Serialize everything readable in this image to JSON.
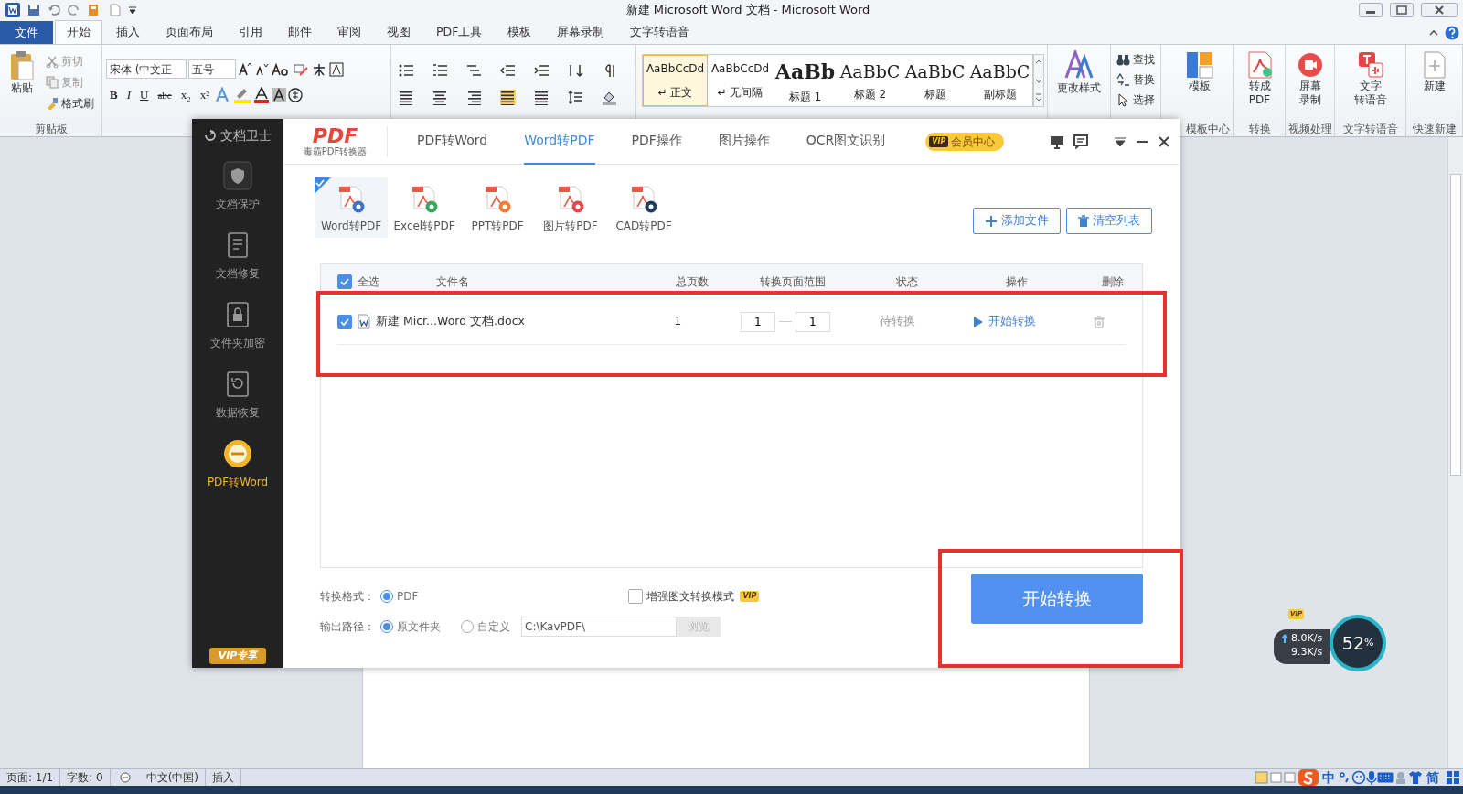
{
  "word": {
    "title": "新建 Microsoft Word 文档 - Microsoft Word",
    "file_tab": "文件",
    "tabs": [
      {
        "label": "开始",
        "selected": true
      },
      {
        "label": "插入",
        "selected": false
      },
      {
        "label": "页面布局",
        "selected": false
      },
      {
        "label": "引用",
        "selected": false
      },
      {
        "label": "邮件",
        "selected": false
      },
      {
        "label": "审阅",
        "selected": false
      },
      {
        "label": "视图",
        "selected": false
      },
      {
        "label": "PDF工具",
        "selected": false
      },
      {
        "label": "模板",
        "selected": false
      },
      {
        "label": "屏幕录制",
        "selected": false
      },
      {
        "label": "文字转语音",
        "selected": false
      }
    ],
    "clipboard": {
      "paste": "粘贴",
      "items": [
        {
          "label": "剪切",
          "disabled": true
        },
        {
          "label": "复制",
          "disabled": true
        },
        {
          "label": "格式刷",
          "disabled": false
        }
      ],
      "group": "剪贴板"
    },
    "font": {
      "name": "宋体 (中文正",
      "size": "五号",
      "buttons": [
        "B",
        "I",
        "U",
        "abc",
        "x₂",
        "x²"
      ]
    },
    "styles": [
      {
        "preview": "AaBbCcDd",
        "label": "↵ 正文",
        "kind": "text",
        "selected": true
      },
      {
        "preview": "AaBbCcDd",
        "label": "↵ 无间隔",
        "kind": "text",
        "selected": false
      },
      {
        "preview": "AaBb",
        "label": "标题 1",
        "kind": "heading1",
        "selected": false
      },
      {
        "preview": "AaBbC",
        "label": "标题 2",
        "kind": "heading",
        "selected": false
      },
      {
        "preview": "AaBbC",
        "label": "标题",
        "kind": "heading",
        "selected": false
      },
      {
        "preview": "AaBbC",
        "label": "副标题",
        "kind": "heading",
        "selected": false
      }
    ],
    "change_styles": "更改样式",
    "editing": [
      "查找",
      "替换",
      "选择"
    ],
    "groups": [
      {
        "lines": [
          "模板"
        ],
        "group": "模板中心",
        "kind": "template"
      },
      {
        "lines": [
          "转成",
          "PDF"
        ],
        "group": "转换",
        "kind": "pdf"
      },
      {
        "lines": [
          "屏幕",
          "录制"
        ],
        "group": "视频处理",
        "kind": "record"
      },
      {
        "lines": [
          "文字",
          "转语音"
        ],
        "group": "文字转语音",
        "kind": "speech"
      },
      {
        "lines": [
          "新建"
        ],
        "group": "快速新建",
        "kind": "new"
      }
    ],
    "status_bar": [
      "页面: 1/1",
      "字数: 0",
      "中文(中国)",
      "插入"
    ],
    "ime": [
      "中",
      "简"
    ]
  },
  "dialog": {
    "sidebar": {
      "brand": "文档卫士",
      "items": [
        {
          "label": "文档保护",
          "kind": "shield",
          "selected": false
        },
        {
          "label": "文档修复",
          "kind": "repair",
          "selected": false
        },
        {
          "label": "文件夹加密",
          "kind": "lock",
          "selected": false
        },
        {
          "label": "数据恢复",
          "kind": "restore",
          "selected": false
        },
        {
          "label": "PDF转Word",
          "kind": "pdf",
          "selected": true
        }
      ],
      "vip": "VIP专享"
    },
    "logo": "PDF",
    "logo_sub": "毒霸PDF转换器",
    "tabs": [
      {
        "label": "PDF转Word",
        "selected": false
      },
      {
        "label": "Word转PDF",
        "selected": true
      },
      {
        "label": "PDF操作",
        "selected": false
      },
      {
        "label": "图片操作",
        "selected": false
      },
      {
        "label": "OCR图文识别",
        "selected": false
      }
    ],
    "member": {
      "badge": "VIP",
      "label": "会员中心"
    },
    "types": [
      {
        "label": "Word转PDF",
        "color": "#3b73c9",
        "selected": true
      },
      {
        "label": "Excel转PDF",
        "color": "#3aa65b",
        "selected": false
      },
      {
        "label": "PPT转PDF",
        "color": "#f07c3a",
        "selected": false
      },
      {
        "label": "图片转PDF",
        "color": "#e5474b",
        "selected": false
      },
      {
        "label": "CAD转PDF",
        "color": "#1f3d5c",
        "selected": false
      }
    ],
    "add_button": "添加文件",
    "clear_button": "清空列表",
    "table": {
      "select_all": {
        "label": "全选",
        "checked": true
      },
      "columns": [
        "文件名",
        "总页数",
        "转换页面范围",
        "状态",
        "操作",
        "删除"
      ],
      "rows": [
        {
          "checked": true,
          "name": "新建 Micr...Word 文档.docx",
          "pages": "1",
          "from": "1",
          "to": "1",
          "status": "待转换",
          "action": "开始转换"
        }
      ]
    },
    "format": {
      "label": "转换格式：",
      "options": [
        {
          "label": "PDF",
          "selected": true
        }
      ]
    },
    "enhance": {
      "label": "增强图文转换模式",
      "checked": false,
      "badge": "VIP"
    },
    "output": {
      "label": "输出路径：",
      "options": [
        {
          "label": "原文件夹",
          "selected": true
        },
        {
          "label": "自定义",
          "selected": false
        }
      ],
      "path": "C:\\KavPDF\\",
      "browse": "浏览",
      "browse_disabled": true
    },
    "start": "开始转换"
  },
  "net": {
    "up": "8.0K/s",
    "down": "9.3K/s",
    "percent": "52",
    "unit": "%",
    "badge": "VIP"
  }
}
